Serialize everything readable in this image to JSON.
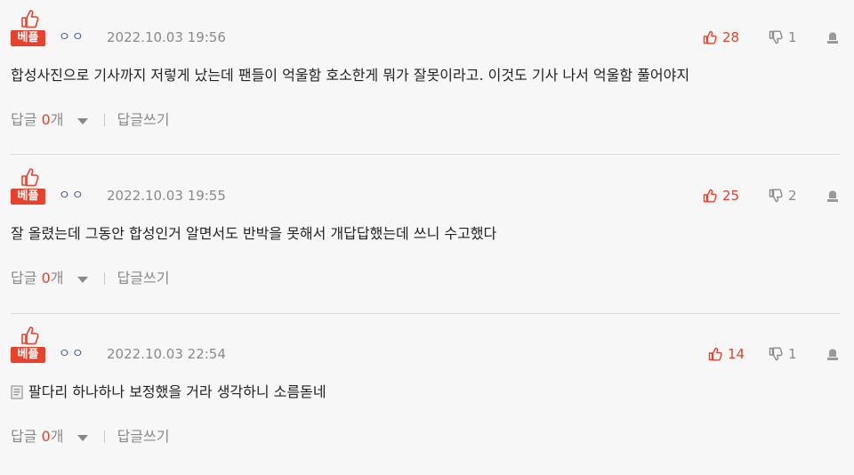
{
  "colors": {
    "accent": "#e8412c",
    "nickname": "#4a5fa8",
    "muted": "#8a8a8a"
  },
  "comments": [
    {
      "badge": "베플",
      "nickname": "ㅇㅇ",
      "date": "2022.10.03 19:56",
      "likes": "28",
      "dislikes": "1",
      "text": "합성사진으로 기사까지 저렇게 났는데 팬들이 억울함 호소한게 뭐가 잘못이라고. 이것도 기사 나서 억울함 풀어야지",
      "reply_label": "답글",
      "reply_count": "0",
      "reply_unit": "개",
      "write_reply": "답글쓰기"
    },
    {
      "badge": "베플",
      "nickname": "ㅇㅇ",
      "date": "2022.10.03 19:55",
      "likes": "25",
      "dislikes": "2",
      "text": "잘 올렸는데 그동안 합성인거 알면서도 반박을 못해서 개답답했는데 쓰니 수고했다",
      "reply_label": "답글",
      "reply_count": "0",
      "reply_unit": "개",
      "write_reply": "답글쓰기"
    },
    {
      "badge": "베플",
      "nickname": "ㅇㅇ",
      "date": "2022.10.03 22:54",
      "likes": "14",
      "dislikes": "1",
      "text": "팔다리 하나하나 보정했을 거라 생각하니 소름돋네",
      "has_doc_icon": true,
      "reply_label": "답글",
      "reply_count": "0",
      "reply_unit": "개",
      "write_reply": "답글쓰기"
    }
  ]
}
